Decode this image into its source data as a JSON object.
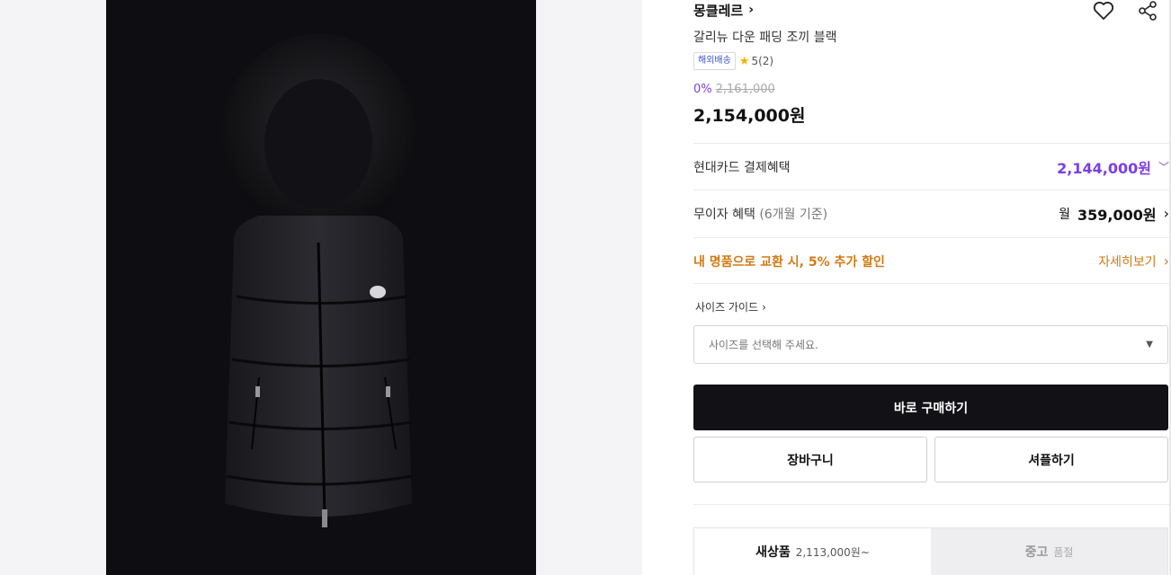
{
  "product": {
    "brand": "몽클레르",
    "title": "갈리뉴 다운 패딩 조끼 블랙",
    "badge": "해외배송",
    "rating": "5(2)",
    "discount": "0%",
    "original_price": "2,161,000",
    "price": "2,154,000원"
  },
  "benefits": {
    "card_label": "현대카드 결제혜택",
    "card_price": "2,144,000원",
    "installment_label": "무이자 혜택",
    "installment_sub": "(6개월 기준)",
    "installment_prefix": "월",
    "installment_price": "359,000원",
    "exchange_label": "내 명품으로 교환 시, 5% 추가 할인",
    "exchange_link": "자세히보기"
  },
  "size": {
    "guide_label": "사이즈 가이드",
    "placeholder": "사이즈를 선택해 주세요."
  },
  "actions": {
    "buy": "바로 구매하기",
    "cart": "장바구니",
    "share": "셔플하기"
  },
  "tabs": {
    "new_label": "새상품",
    "new_price": "2,113,000원~",
    "used_label": "중고",
    "used_status": "품절"
  },
  "colors": {
    "accent_purple": "#7b3fe4",
    "accent_orange": "#d17a14",
    "buy_button": "#121216"
  },
  "icons": {
    "wishlist": "heart-icon",
    "share": "share-icon",
    "star": "star-icon"
  }
}
